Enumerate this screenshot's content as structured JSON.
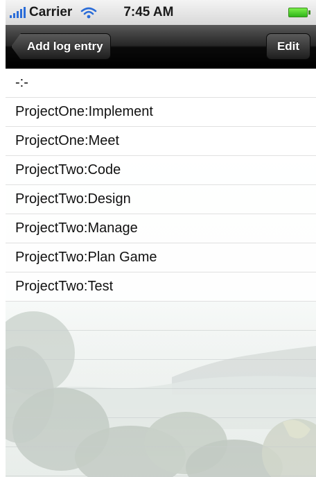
{
  "status_bar": {
    "carrier": "Carrier",
    "time": "7:45 AM",
    "signal_icon": "signal-bars-icon",
    "wifi_icon": "wifi-icon",
    "battery_icon": "battery-icon"
  },
  "nav_bar": {
    "back_label": "Add log entry",
    "edit_label": "Edit"
  },
  "list": {
    "items": [
      "-:-",
      "ProjectOne:Implement",
      "ProjectOne:Meet",
      "ProjectTwo:Code",
      "ProjectTwo:Design",
      "ProjectTwo:Manage",
      "ProjectTwo:Plan Game",
      "ProjectTwo:Test"
    ]
  },
  "colors": {
    "nav_bar": "#1a1a1a",
    "status_bar": "#e0e0e0",
    "signal": "#2a6cd8",
    "battery": "#3cc424"
  }
}
